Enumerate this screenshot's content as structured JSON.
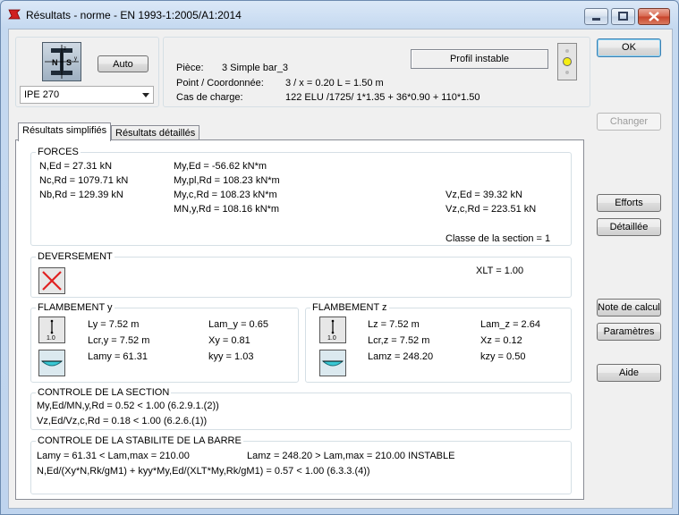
{
  "window": {
    "title": "Résultats - norme - EN 1993-1:2005/A1:2014"
  },
  "profile": {
    "auto_label": "Auto",
    "selected": "IPE 270"
  },
  "info": {
    "piece_label": "Pièce:",
    "piece_value": "3  Simple bar_3",
    "point_label": "Point / Coordonnée:",
    "point_value": "3 / x = 0.20 L = 1.50 m",
    "cas_label": "Cas de charge:",
    "cas_value": "122 ELU /1725/  1*1.35 + 36*0.90 + 110*1.50",
    "status": "Profil instable"
  },
  "tabs": {
    "simplified": "Résultats simplifiés",
    "detailed": "Résultats détaillés"
  },
  "forces": {
    "title": "FORCES",
    "ned": "N,Ed = 27.31 kN",
    "ncrd": "Nc,Rd = 1079.71 kN",
    "nbrd": "Nb,Rd = 129.39 kN",
    "myed": "My,Ed = -56.62 kN*m",
    "myplrd": "My,pl,Rd = 108.23 kN*m",
    "mycrd": "My,c,Rd = 108.23 kN*m",
    "mnyrd": "MN,y,Rd = 108.16 kN*m",
    "vzed": "Vz,Ed = 39.32 kN",
    "vzcrd": "Vz,c,Rd = 223.51 kN",
    "classe": "Classe de la section = 1"
  },
  "deversement": {
    "title": "DEVERSEMENT",
    "xlt": "XLT = 1.00"
  },
  "flambement_y": {
    "title": "FLAMBEMENT y",
    "icon_label": "1.0",
    "ly": "Ly = 7.52 m",
    "lcr": "Lcr,y = 7.52 m",
    "lam": "Lamy = 61.31",
    "lamrel": "Lam_y = 0.65",
    "x": "Xy = 0.81",
    "k": "kyy = 1.03"
  },
  "flambement_z": {
    "title": "FLAMBEMENT z",
    "icon_label": "1.0",
    "lz": "Lz = 7.52 m",
    "lcr": "Lcr,z = 7.52 m",
    "lam": "Lamz = 248.20",
    "lamrel": "Lam_z = 2.64",
    "x": "Xz = 0.12",
    "k": "kzy = 0.50"
  },
  "controle_section": {
    "title": "CONTROLE DE LA SECTION",
    "line1": "My,Ed/MN,y,Rd = 0.52 < 1.00   (6.2.9.1.(2))",
    "line2": "Vz,Ed/Vz,c,Rd = 0.18 < 1.00   (6.2.6.(1))"
  },
  "controle_stabilite": {
    "title": "CONTROLE DE LA STABILITE DE LA BARRE",
    "lamy": "Lamy = 61.31 < Lam,max = 210.00",
    "lamz": "Lamz = 248.20 > Lam,max = 210.00    INSTABLE",
    "formula": "N,Ed/(Xy*N,Rk/gM1) + kyy*My,Ed/(XLT*My,Rk/gM1) = 0.57 < 1.00   (6.3.3.(4))"
  },
  "buttons": {
    "ok": "OK",
    "changer": "Changer",
    "efforts": "Efforts",
    "detaillee": "Détaillée",
    "note": "Note de calcul",
    "parametres": "Paramètres",
    "aide": "Aide"
  }
}
